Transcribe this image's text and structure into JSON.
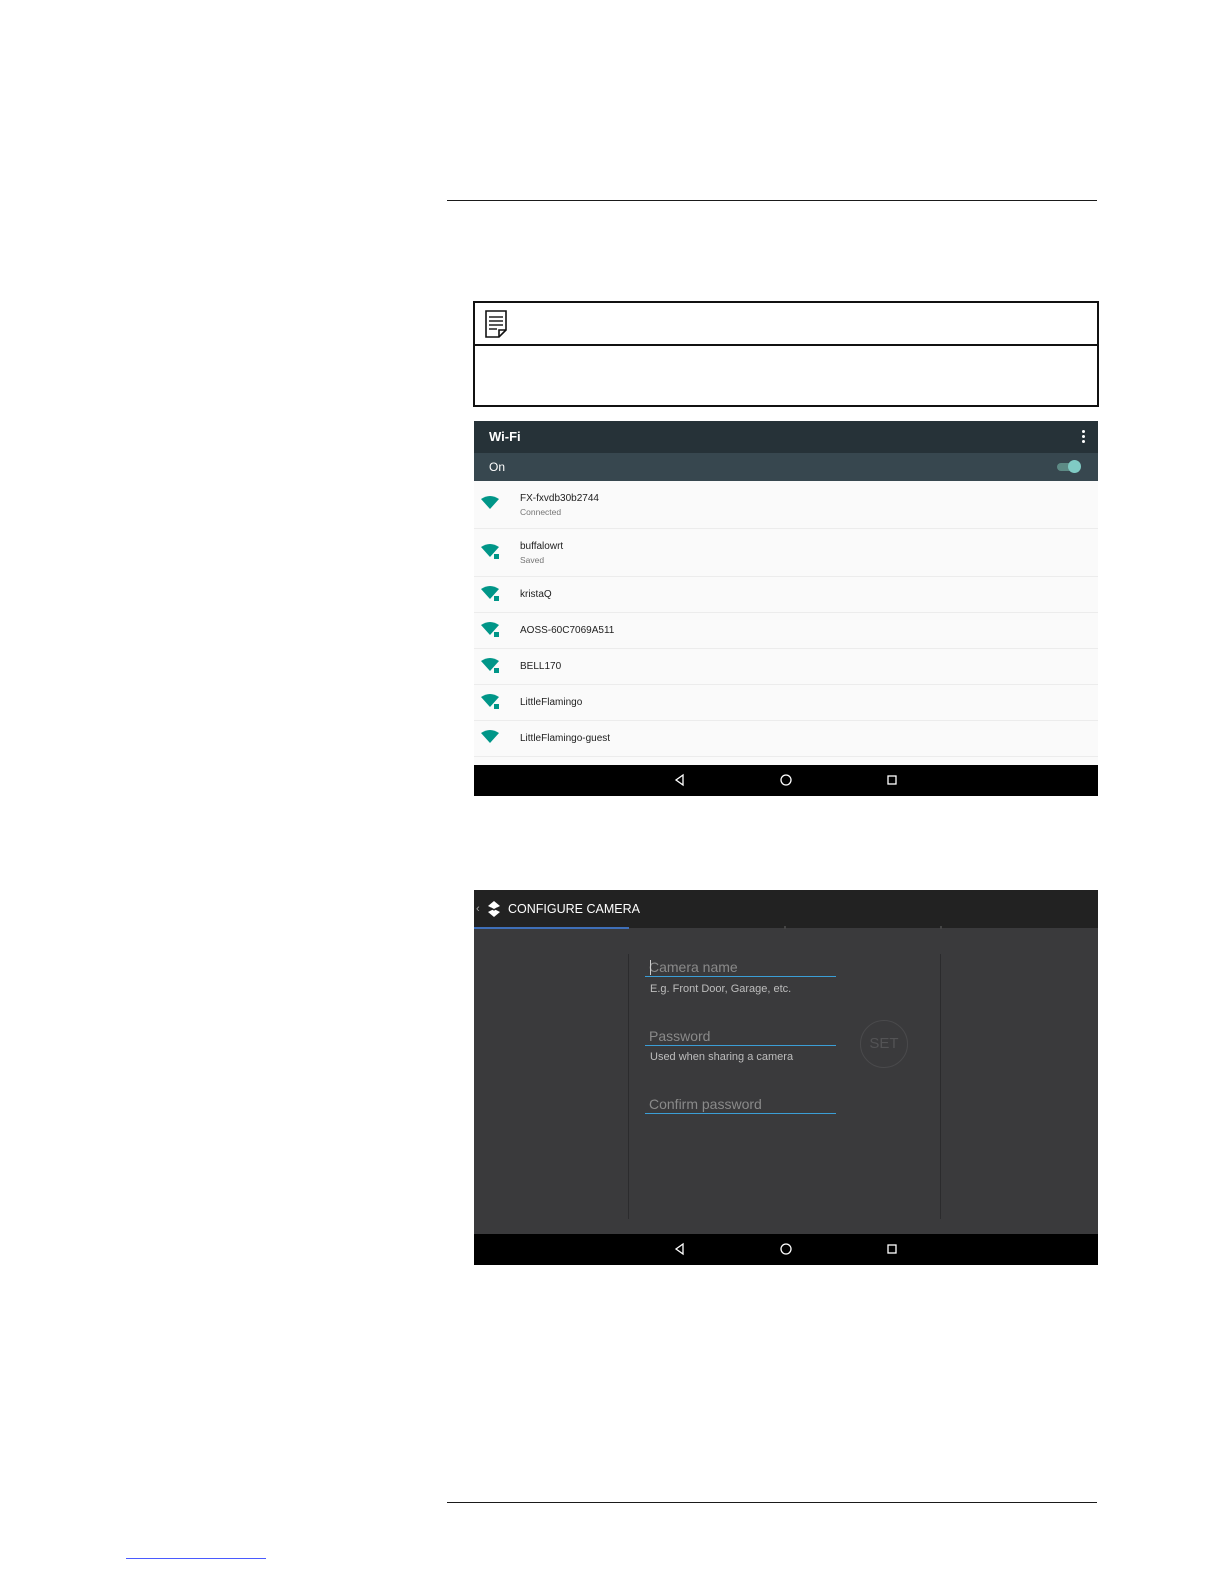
{
  "wifi_screen": {
    "title": "Wi-Fi",
    "status_label": "On",
    "toggle_on": true,
    "accent_color": "#009688",
    "networks": [
      {
        "name": "FX-fxvdb30b2744",
        "status": "Connected",
        "icon": "wifi-signal-icon"
      },
      {
        "name": "buffalowrt",
        "status": "Saved",
        "icon": "wifi-signal-locked-icon"
      },
      {
        "name": "kristaQ",
        "status": "",
        "icon": "wifi-signal-locked-icon"
      },
      {
        "name": "AOSS-60C7069A511",
        "status": "",
        "icon": "wifi-signal-locked-icon"
      },
      {
        "name": "BELL170",
        "status": "",
        "icon": "wifi-signal-locked-icon"
      },
      {
        "name": "LittleFlamingo",
        "status": "",
        "icon": "wifi-signal-locked-icon"
      },
      {
        "name": "LittleFlamingo-guest",
        "status": "",
        "icon": "wifi-signal-icon"
      }
    ]
  },
  "configure_screen": {
    "title": "CONFIGURE CAMERA",
    "camera_name": {
      "placeholder": "Camera name",
      "helper": "E.g. Front Door, Garage, etc."
    },
    "password": {
      "placeholder": "Password",
      "helper": "Used when sharing a camera"
    },
    "confirm_password": {
      "placeholder": "Confirm password"
    },
    "set_button": "SET",
    "accent_color": "#3b9ed6"
  }
}
